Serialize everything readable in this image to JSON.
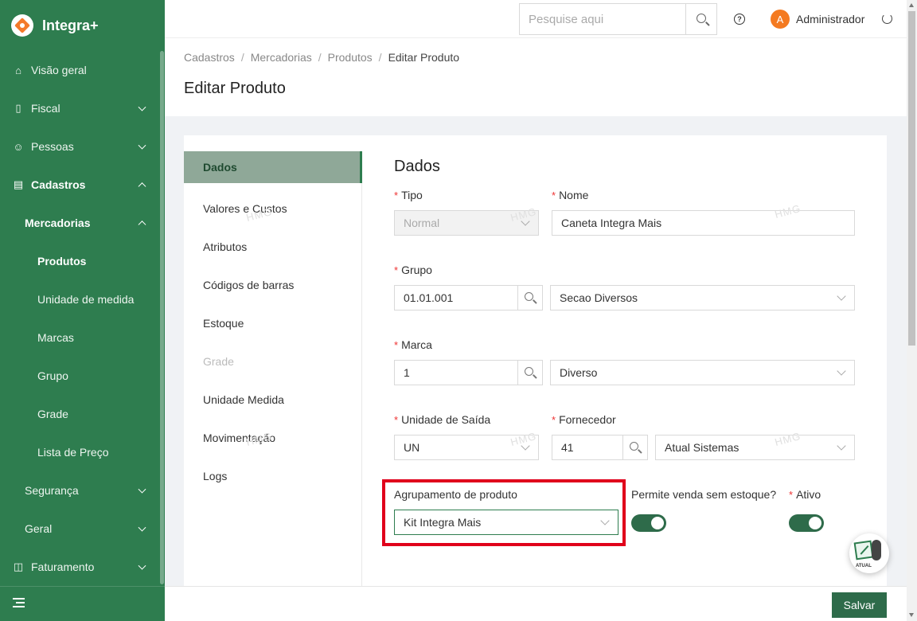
{
  "app": {
    "name": "Integra+"
  },
  "sidebar": {
    "items": [
      {
        "label": "Visão geral"
      },
      {
        "label": "Fiscal"
      },
      {
        "label": "Pessoas"
      },
      {
        "label": "Cadastros"
      },
      {
        "label": "Mercadorias"
      },
      {
        "label": "Produtos"
      },
      {
        "label": "Unidade de medida"
      },
      {
        "label": "Marcas"
      },
      {
        "label": "Grupo"
      },
      {
        "label": "Grade"
      },
      {
        "label": "Lista de Preço"
      },
      {
        "label": "Segurança"
      },
      {
        "label": "Geral"
      },
      {
        "label": "Faturamento"
      }
    ]
  },
  "header": {
    "search_placeholder": "Pesquise aqui",
    "avatar_letter": "A",
    "user_name": "Administrador"
  },
  "breadcrumb": [
    "Cadastros",
    "Mercadorias",
    "Produtos",
    "Editar Produto"
  ],
  "page_title": "Editar Produto",
  "tabs": [
    "Dados",
    "Valores e Custos",
    "Atributos",
    "Códigos de barras",
    "Estoque",
    "Grade",
    "Unidade Medida",
    "Movimentação",
    "Logs"
  ],
  "form": {
    "title": "Dados",
    "required_mark": "*",
    "watermark": "HMG",
    "tipo": {
      "label": "Tipo",
      "value": "Normal"
    },
    "nome": {
      "label": "Nome",
      "value": "Caneta Integra Mais"
    },
    "grupo": {
      "label": "Grupo",
      "code": "01.01.001",
      "desc": "Secao Diversos"
    },
    "marca": {
      "label": "Marca",
      "code": "1",
      "desc": "Diverso"
    },
    "unidade_saida": {
      "label": "Unidade de Saída",
      "value": "UN"
    },
    "fornecedor": {
      "label": "Fornecedor",
      "code": "41",
      "desc": "Atual Sistemas"
    },
    "agrupamento": {
      "label": "Agrupamento de produto",
      "value": "Kit Integra Mais"
    },
    "permite_venda": {
      "label": "Permite venda sem estoque?",
      "checked": true
    },
    "ativo": {
      "label": "Ativo",
      "checked": true
    }
  },
  "fab_text": "ATUAL",
  "footer": {
    "save_label": "Salvar"
  },
  "colors": {
    "brand_green": "#2e7d4f",
    "accent_orange": "#f47a20",
    "highlight_red": "#e0001b"
  }
}
